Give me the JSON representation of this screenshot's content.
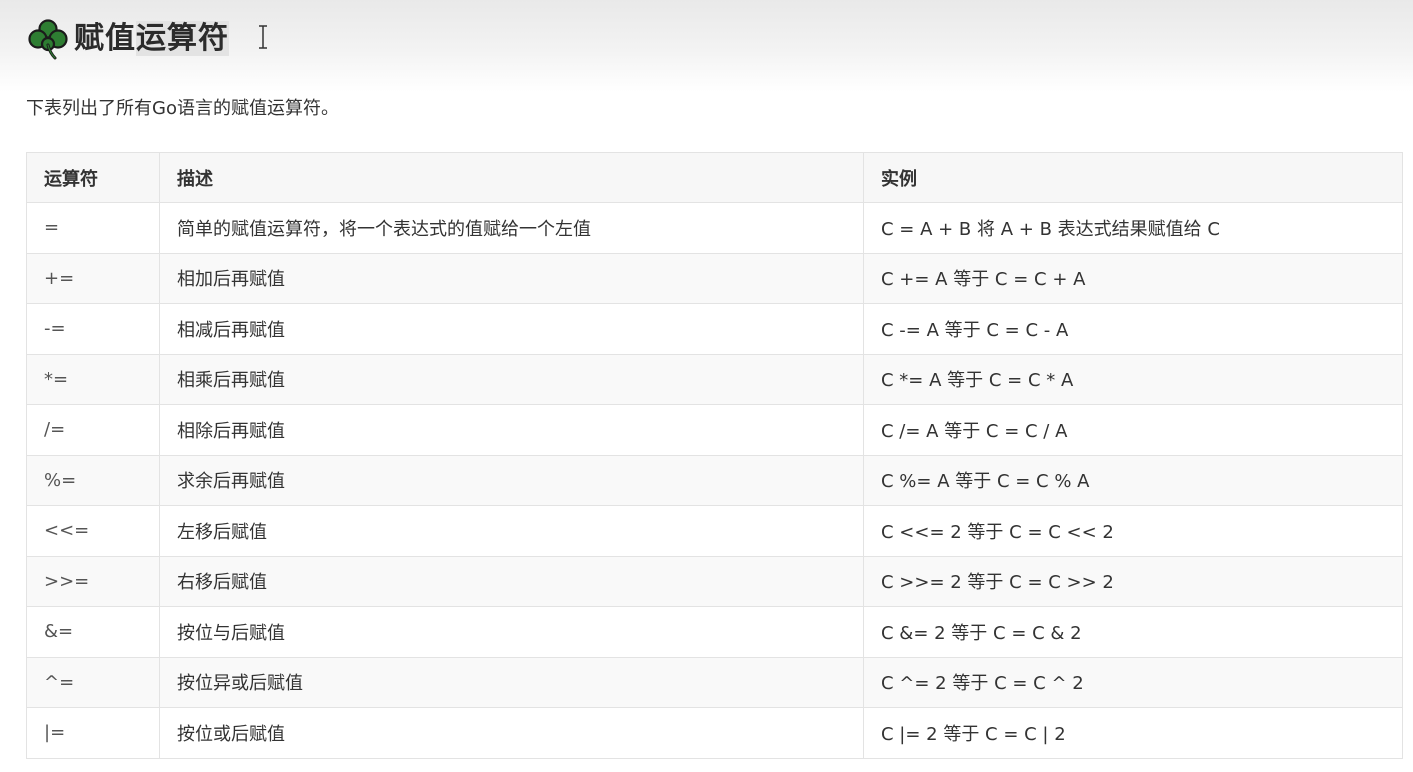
{
  "section": {
    "title_plain": "赋值",
    "title_highlight": "运算符",
    "icon": "clover-icon",
    "icon_color": "#2e7d32"
  },
  "intro": "下表列出了所有Go语言的赋值运算符。",
  "table": {
    "headers": [
      "运算符",
      "描述",
      "实例"
    ],
    "rows": [
      {
        "op": "=",
        "desc": "简单的赋值运算符，将一个表达式的值赋给一个左值",
        "example": "C = A + B 将 A + B 表达式结果赋值给 C"
      },
      {
        "op": "+=",
        "desc": "相加后再赋值",
        "example": "C += A 等于 C = C + A"
      },
      {
        "op": "-=",
        "desc": "相减后再赋值",
        "example": "C -= A 等于 C = C - A"
      },
      {
        "op": "*=",
        "desc": "相乘后再赋值",
        "example": "C *= A 等于 C = C * A"
      },
      {
        "op": "/=",
        "desc": "相除后再赋值",
        "example": "C /= A 等于 C = C / A"
      },
      {
        "op": "%=",
        "desc": "求余后再赋值",
        "example": "C %= A 等于 C = C % A"
      },
      {
        "op": "<<=",
        "desc": "左移后赋值",
        "example": "C <<= 2 等于 C = C << 2"
      },
      {
        "op": ">>=",
        "desc": "右移后赋值",
        "example": "C >>= 2 等于 C = C >> 2"
      },
      {
        "op": "&=",
        "desc": "按位与后赋值",
        "example": "C &= 2 等于 C = C & 2"
      },
      {
        "op": "^=",
        "desc": "按位异或后赋值",
        "example": "C ^= 2 等于 C = C ^ 2"
      },
      {
        "op": "|=",
        "desc": "按位或后赋值",
        "example": "C |= 2 等于 C = C | 2"
      }
    ]
  }
}
